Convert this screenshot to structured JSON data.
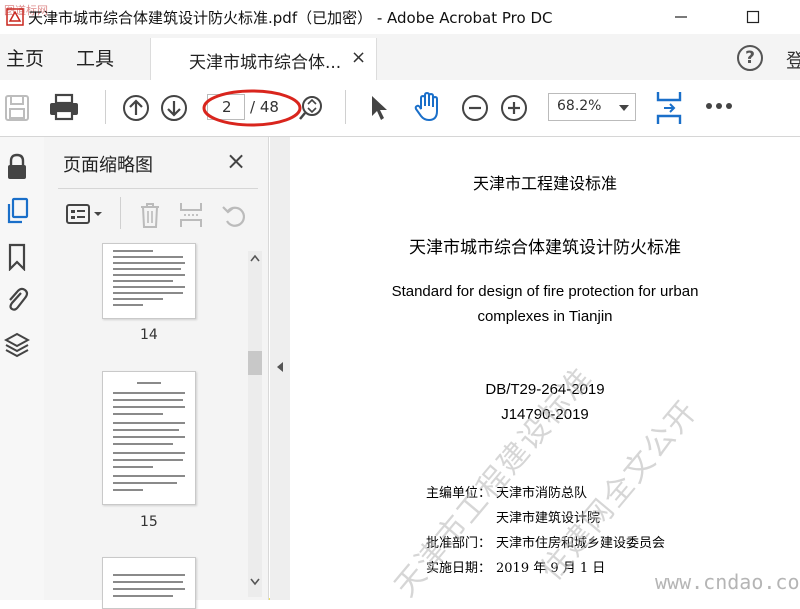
{
  "window": {
    "title": "天津市城市综合体建筑设计防火标准.pdf（已加密） - Adobe Acrobat Pro DC",
    "corner_watermark": "图道标网"
  },
  "menubar": {
    "home": "主页",
    "tools": "工具",
    "tab_label": "天津市城市综合体...",
    "tab_close": "×",
    "help": "?",
    "sign_in": "登"
  },
  "toolbar": {
    "page_current": "2",
    "page_total": "/ 48",
    "zoom": "68.2%"
  },
  "panel": {
    "title": "页面缩略图",
    "close": "×",
    "thumbnails": [
      {
        "label": "14"
      },
      {
        "label": "15"
      }
    ]
  },
  "document": {
    "series": "天津市工程建设标准",
    "title_cn": "天津市城市综合体建筑设计防火标准",
    "title_en_1": "Standard for design of fire protection for urban",
    "title_en_2": "complexes in Tianjin",
    "code_1": "DB/T29-264-2019",
    "code_2": "J14790-2019",
    "editor_label": "主编单位：",
    "editor_1": "天津市消防总队",
    "editor_2": "天津市建筑设计院",
    "approval_label": "批准部门：",
    "approval": "天津市住房和城乡建设委员会",
    "effective_label": "实施日期：",
    "effective": "2019 年 9 月 1 日",
    "watermark_1": "天津市工程建设标准",
    "watermark_2": "住建网全文公开",
    "site_watermark": "www.cndao.com"
  },
  "colors": {
    "accent_blue": "#1a6fc9",
    "highlight_circle": "#d9251d",
    "frame_yellow": "#f2e25a"
  }
}
